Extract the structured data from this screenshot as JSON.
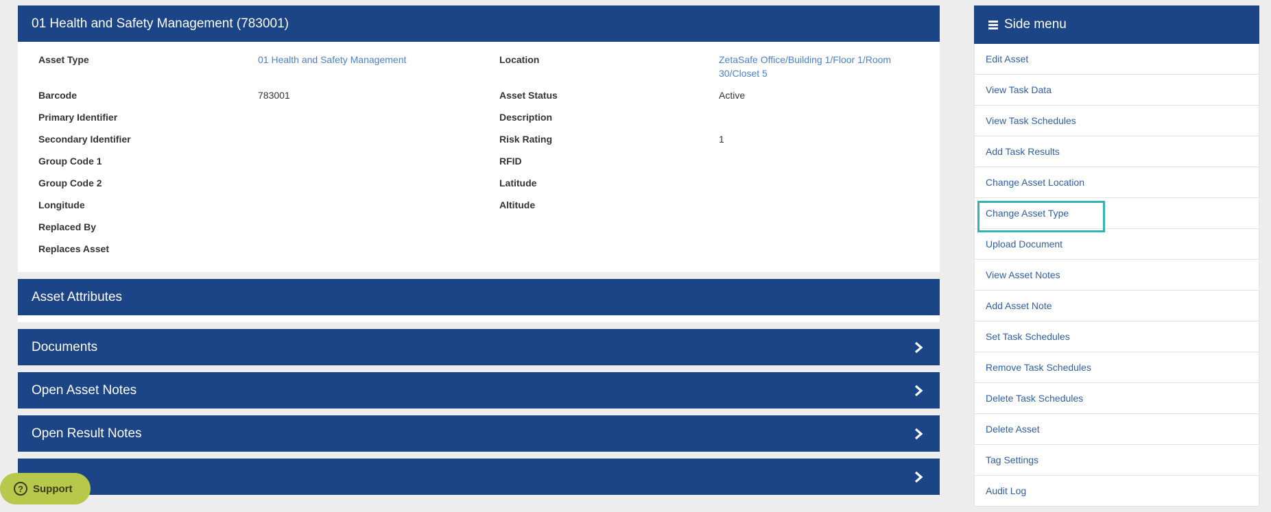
{
  "asset_panel": {
    "title": "01 Health and Safety Management (783001)",
    "fields": [
      {
        "label": "Asset Type",
        "value": "01 Health and Safety Management",
        "link": true,
        "label2": "Location",
        "value2": "ZetaSafe Office/Building 1/Floor 1/Room 30/Closet 5",
        "link2": true
      },
      {
        "label": "Barcode",
        "value": "783001",
        "label2": "Asset Status",
        "value2": "Active"
      },
      {
        "label": "Primary Identifier",
        "value": "",
        "label2": "Description",
        "value2": ""
      },
      {
        "label": "Secondary Identifier",
        "value": "",
        "label2": "Risk Rating",
        "value2": "1"
      },
      {
        "label": "Group Code 1",
        "value": "",
        "label2": "RFID",
        "value2": ""
      },
      {
        "label": "Group Code 2",
        "value": "",
        "label2": "Latitude",
        "value2": ""
      },
      {
        "label": "Longitude",
        "value": "",
        "label2": "Altitude",
        "value2": ""
      },
      {
        "label": "Replaced By",
        "value": "",
        "label2": "",
        "value2": ""
      },
      {
        "label": "Replaces Asset",
        "value": "",
        "label2": "",
        "value2": ""
      }
    ]
  },
  "sections": {
    "asset_attributes": "Asset Attributes",
    "documents": "Documents",
    "open_asset_notes": "Open Asset Notes",
    "open_result_notes": "Open Result Notes",
    "last": ""
  },
  "side_menu": {
    "title": "Side menu",
    "items": [
      "Edit Asset",
      "View Task Data",
      "View Task Schedules",
      "Add Task Results",
      "Change Asset Location",
      "Change Asset Type",
      "Upload Document",
      "View Asset Notes",
      "Add Asset Note",
      "Set Task Schedules",
      "Remove Task Schedules",
      "Delete Task Schedules",
      "Delete Asset",
      "Tag Settings",
      "Audit Log"
    ]
  },
  "support": {
    "label": "Support"
  },
  "colors": {
    "header": "#1c4587",
    "link": "#4a7fd0",
    "highlight": "#35b3b3",
    "support": "#b7c94a"
  }
}
